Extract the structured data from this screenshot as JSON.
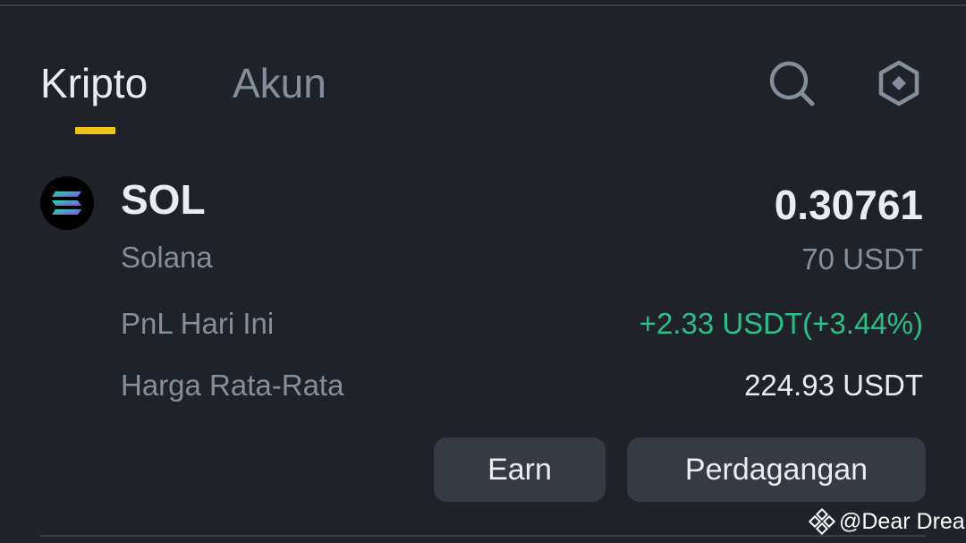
{
  "tabs": {
    "active": "Kripto",
    "inactive": "Akun"
  },
  "header_icons": {
    "search": "search-icon",
    "settings": "hexagon-settings-icon"
  },
  "asset": {
    "symbol": "SOL",
    "name": "Solana",
    "amount": "0.30761",
    "value": "70 USDT",
    "pnl_label": "PnL Hari Ini",
    "pnl_value": "+2.33 USDT(+3.44%)",
    "avg_price_label": "Harga Rata-Rata",
    "avg_price_value": "224.93 USDT",
    "logo_icon": "solana-logo"
  },
  "buttons": {
    "earn": "Earn",
    "trade": "Perdagangan"
  },
  "watermark": {
    "text": "@Dear Drea",
    "icon": "binance-logo"
  },
  "colors": {
    "background": "#1f2329",
    "accent": "#f0c419",
    "positive": "#2ebd85",
    "text_primary": "#eaecef",
    "text_secondary": "#848e9c",
    "button_bg": "#353a44"
  }
}
